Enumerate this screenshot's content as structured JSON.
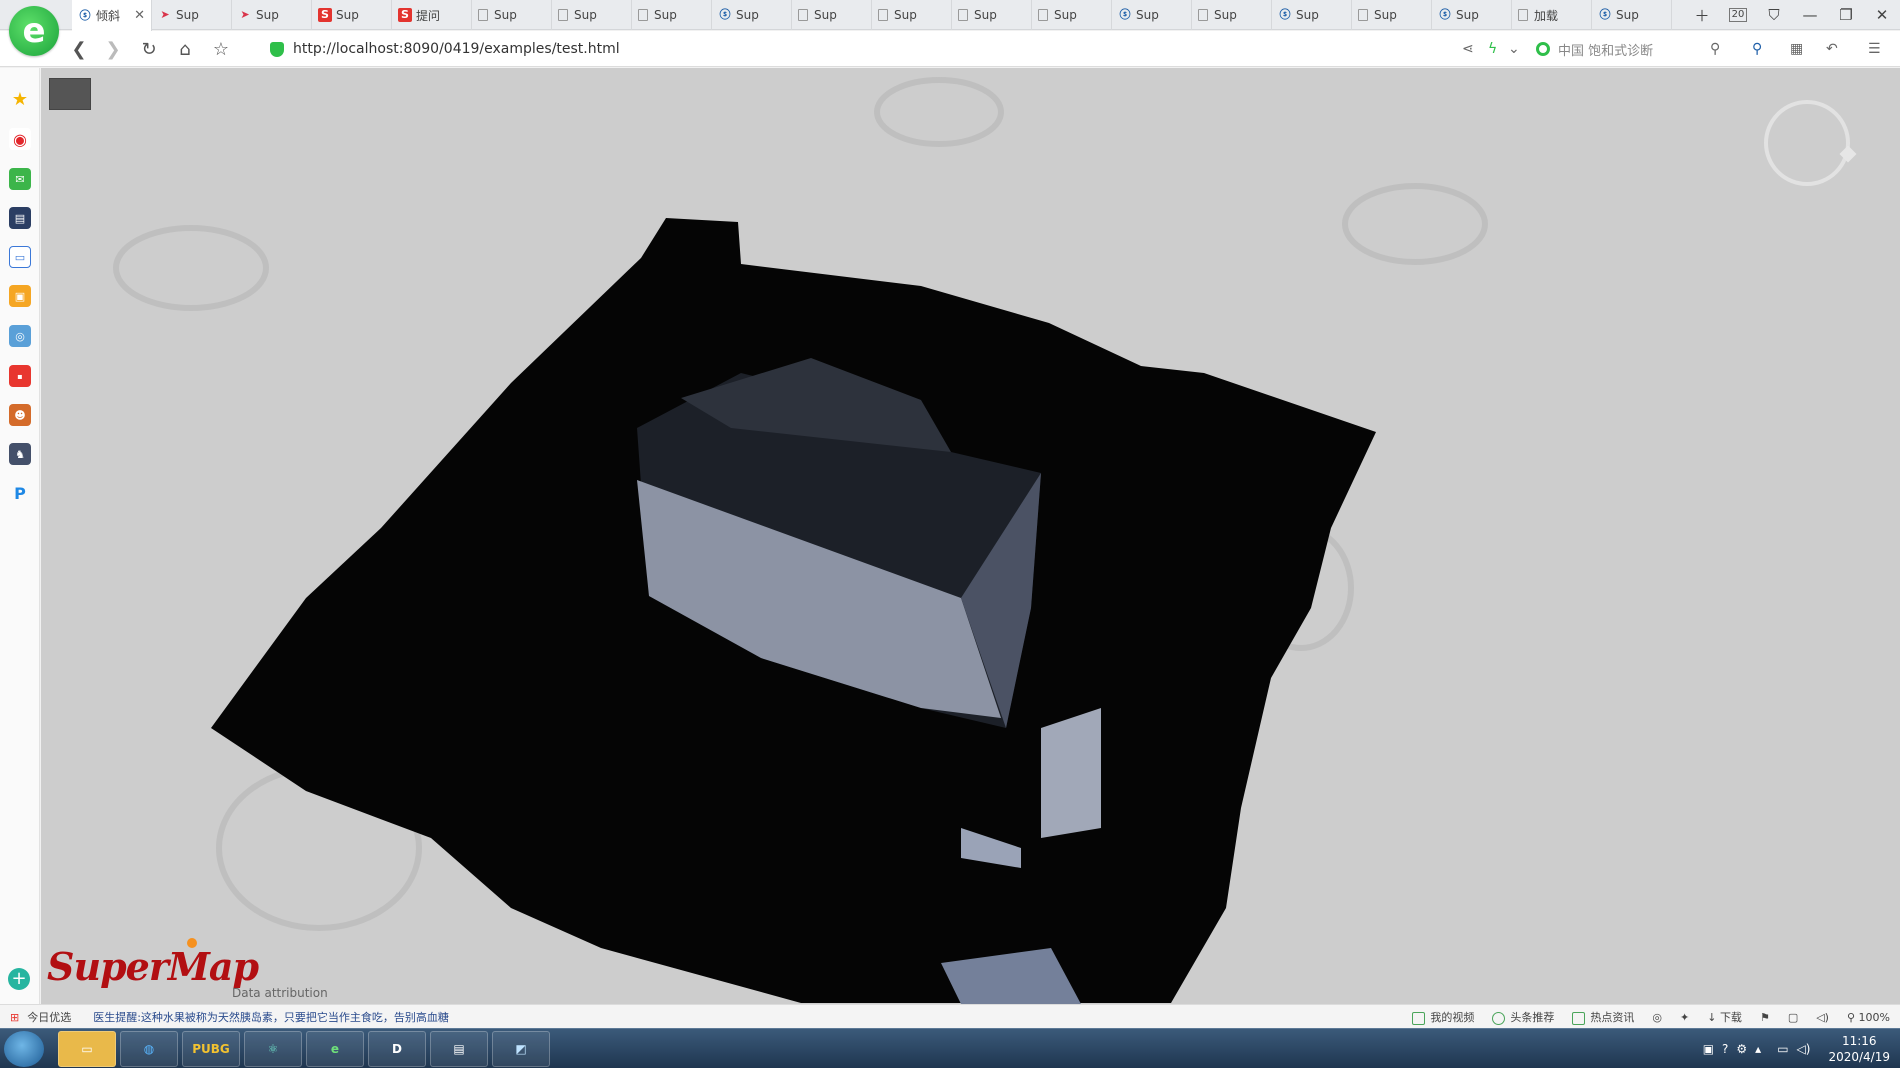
{
  "browser": {
    "logo": "e",
    "tabs": [
      {
        "icon": "sm",
        "label": "倾斜"
      },
      {
        "icon": "arrow",
        "label": "Sup"
      },
      {
        "icon": "arrow",
        "label": "Sup"
      },
      {
        "icon": "s",
        "label": "Sup"
      },
      {
        "icon": "s",
        "label": "提问"
      },
      {
        "icon": "doc",
        "label": "Sup"
      },
      {
        "icon": "doc",
        "label": "Sup"
      },
      {
        "icon": "doc",
        "label": "Sup"
      },
      {
        "icon": "sm",
        "label": "Sup"
      },
      {
        "icon": "doc",
        "label": "Sup"
      },
      {
        "icon": "doc",
        "label": "Sup"
      },
      {
        "icon": "doc",
        "label": "Sup"
      },
      {
        "icon": "doc",
        "label": "Sup"
      },
      {
        "icon": "sm",
        "label": "Sup"
      },
      {
        "icon": "doc",
        "label": "Sup"
      },
      {
        "icon": "sm",
        "label": "Sup"
      },
      {
        "icon": "doc",
        "label": "Sup"
      },
      {
        "icon": "sm",
        "label": "Sup"
      },
      {
        "icon": "doc",
        "label": "加载"
      },
      {
        "icon": "sm",
        "label": "Sup"
      }
    ],
    "tab_count": "20",
    "url": "http://localhost:8090/0419/examples/test.html",
    "search_placeholder": "中国 饱和式诊断"
  },
  "viewport": {
    "logo_text": "SuperMap",
    "attribution": "Data attribution"
  },
  "statusbar": {
    "left_label": "今日优选",
    "news": "医生提醒:这种水果被称为天然胰岛素，只要把它当作主食吃，告别高血糖",
    "right_items": [
      "我的视频",
      "头条推荐",
      "热点资讯"
    ],
    "download_label": "下载",
    "zoom": "100%"
  },
  "taskbar": {
    "time": "11:16",
    "date": "2020/4/19",
    "apps": [
      "explorer",
      "browser",
      "PUBG",
      "atom",
      "ie",
      "d-app",
      "window",
      "tool"
    ]
  }
}
